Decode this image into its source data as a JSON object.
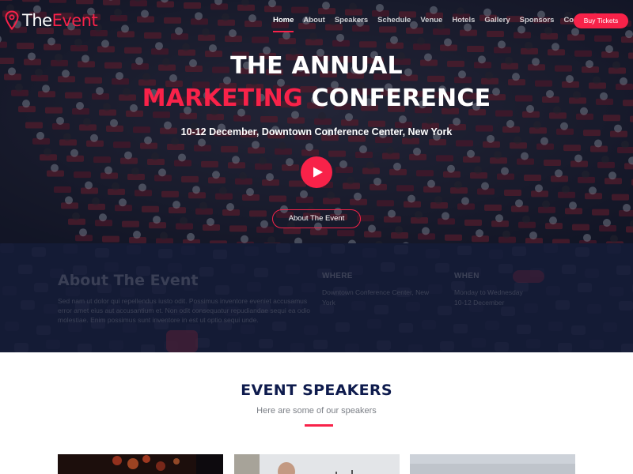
{
  "brand": {
    "name_main": "The",
    "name_accent": "Event",
    "accent_color": "#f82249",
    "icon": "map-pin-icon"
  },
  "nav": {
    "items": [
      {
        "label": "Home",
        "active": true
      },
      {
        "label": "About",
        "active": false
      },
      {
        "label": "Speakers",
        "active": false
      },
      {
        "label": "Schedule",
        "active": false
      },
      {
        "label": "Venue",
        "active": false
      },
      {
        "label": "Hotels",
        "active": false
      },
      {
        "label": "Gallery",
        "active": false
      },
      {
        "label": "Sponsors",
        "active": false
      },
      {
        "label": "Contact",
        "active": false
      }
    ],
    "cta_label": "Buy Tickets"
  },
  "hero": {
    "line1": "THE ANNUAL",
    "line2_accent": "MARKETING",
    "line2_rest": " CONFERENCE",
    "subtitle": "10-12 December, Downtown Conference Center, New York",
    "play_icon": "play-icon",
    "about_button": "About The Event"
  },
  "about": {
    "title": "About The Event",
    "text": "Sed nam ut dolor qui repellendus iusto odit. Possimus inventore eveniet accusamus error amet eius aut accusantium et. Non odit consequatur repudiandae sequi ea odio molestiae. Enim possimus sunt inventore in est ut optio sequi unde.",
    "where_label": "Where",
    "where_value": "Downtown Conference Center, New York",
    "when_label": "When",
    "when_value_line1": "Monday to Wednesday",
    "when_value_line2": "10-12 December"
  },
  "speakers": {
    "title": "Event Speakers",
    "subtitle": "Here are some of our speakers"
  }
}
